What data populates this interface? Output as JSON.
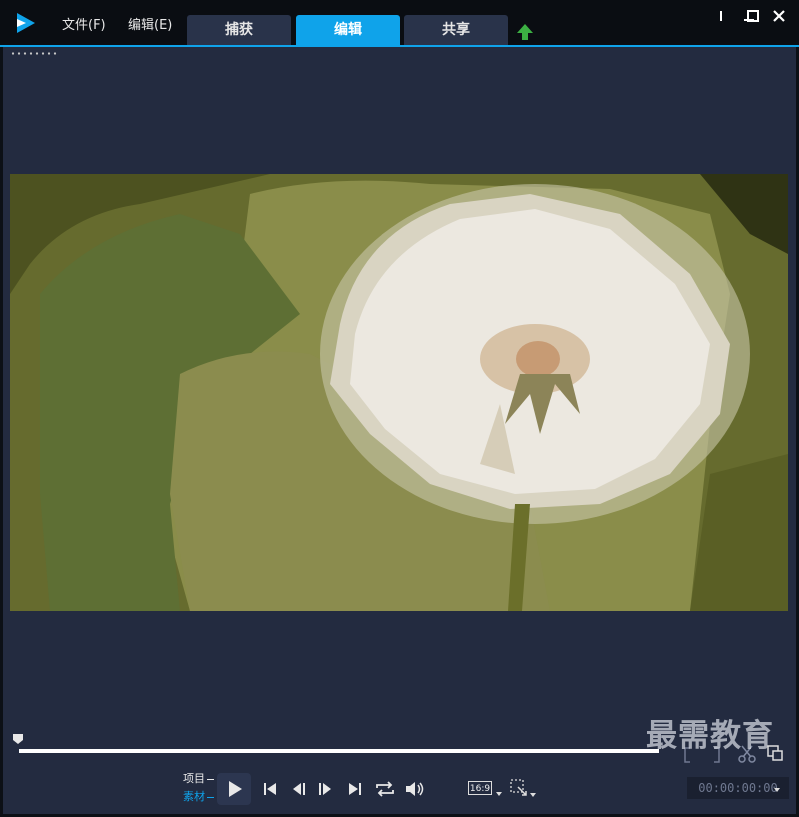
{
  "menu": {
    "file": "文件(F)",
    "edit": "编辑(E)"
  },
  "tabs": [
    {
      "label": "捕获",
      "active": false
    },
    {
      "label": "编辑",
      "active": true
    },
    {
      "label": "共享",
      "active": false
    }
  ],
  "player": {
    "mode_project": "项目",
    "mode_clip": "素材",
    "aspect_ratio": "16:9",
    "timecode": "00:00:00:00"
  },
  "watermark": "最需教育",
  "colors": {
    "accent": "#0fa3ea",
    "panel": "#232b40",
    "upload_green": "#3cb043"
  },
  "icons": {
    "logo": "video-studio-logo-icon",
    "upload": "upload-arrow-icon",
    "play": "play-icon",
    "home": "go-to-start-icon",
    "prev_frame": "previous-frame-icon",
    "next_frame": "next-frame-icon",
    "end": "go-to-end-icon",
    "repeat": "repeat-icon",
    "volume": "volume-icon",
    "resize": "resize-crop-icon",
    "scissors": "scissors-icon"
  }
}
